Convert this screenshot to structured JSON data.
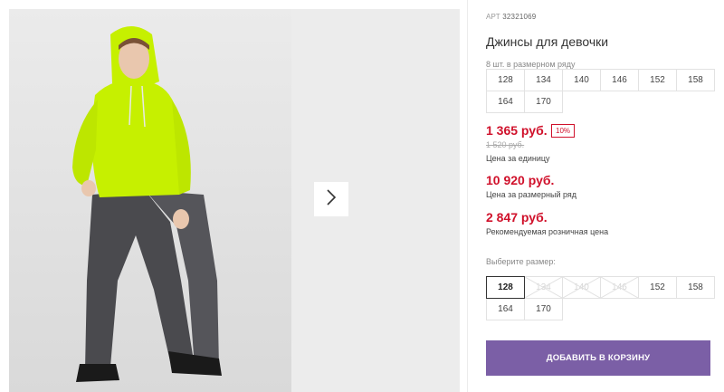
{
  "product": {
    "sku_prefix": "АРТ",
    "sku": "32321069",
    "title": "Джинсы для девочки"
  },
  "series": {
    "label": "8 шт. в размерном ряду",
    "sizes": [
      "128",
      "134",
      "140",
      "146",
      "152",
      "158",
      "164",
      "170"
    ]
  },
  "prices": {
    "unit_price": "1 365 руб.",
    "discount": "10%",
    "old_price": "1 520 руб.",
    "unit_note": "Цена за единицу",
    "series_price": "10 920 руб.",
    "series_note": "Цена за размерный ряд",
    "retail_price": "2 847 руб.",
    "retail_note": "Рекомендуемая розничная цена"
  },
  "size_select": {
    "label": "Выберите размер:",
    "sizes": [
      {
        "size": "128",
        "state": "selected"
      },
      {
        "size": "134",
        "state": "disabled"
      },
      {
        "size": "140",
        "state": "disabled"
      },
      {
        "size": "146",
        "state": "disabled"
      },
      {
        "size": "152",
        "state": "available"
      },
      {
        "size": "158",
        "state": "available"
      },
      {
        "size": "164",
        "state": "available"
      },
      {
        "size": "170",
        "state": "available"
      }
    ]
  },
  "actions": {
    "add_to_cart": "ДОБАВИТЬ В КОРЗИНУ"
  },
  "gallery": {
    "next_icon": "chevron-right-icon"
  },
  "colors": {
    "price_red": "#d0112b",
    "button_purple": "#7b5fa6",
    "hoodie_lime": "#c6f000"
  }
}
